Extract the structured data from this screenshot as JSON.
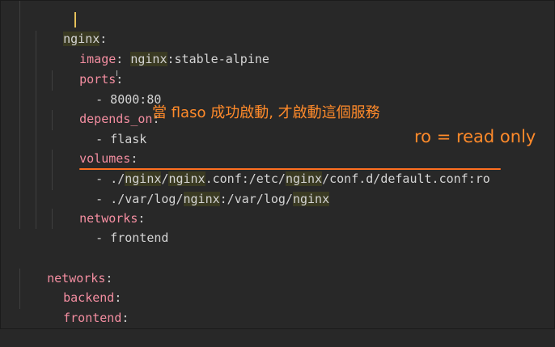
{
  "code": {
    "nginx_key": "nginx",
    "image_key": "image",
    "image_nginx": "nginx",
    "image_rest": ":stable-alpine",
    "ports_key": "ports",
    "ports_item": "- 8000:80",
    "depends_on_key": "depends_on",
    "depends_on_item": "- flask",
    "volumes_key": "volumes",
    "volume1_dash": "- ",
    "volume1_a": "./",
    "volume1_nginx1": "nginx",
    "volume1_b": "/",
    "volume1_nginx2": "nginx",
    "volume1_c": ".conf:/etc/",
    "volume1_nginx3": "nginx",
    "volume1_d": "/conf.d/default.conf:ro",
    "volume2_dash": "- ",
    "volume2_a": "./var/log/",
    "volume2_nginx": "nginx",
    "volume2_b": ":/var/log/",
    "volume2_nginx2": "nginx",
    "networks_key": "networks",
    "networks_item": "- frontend",
    "top_networks_key": "networks",
    "backend_key": "backend",
    "frontend_key": "frontend",
    "colon": ":"
  },
  "annotations": {
    "note_1": "當 flaso 成功啟動, 才啟動這個服務",
    "note_2": "ro = read only"
  },
  "colors": {
    "background": "#282828",
    "key": "#f48ea1",
    "text": "#d4d4d4",
    "highlight": "#3a3a22",
    "annotation": "#ff8a2a",
    "underline": "#ff6f20"
  }
}
